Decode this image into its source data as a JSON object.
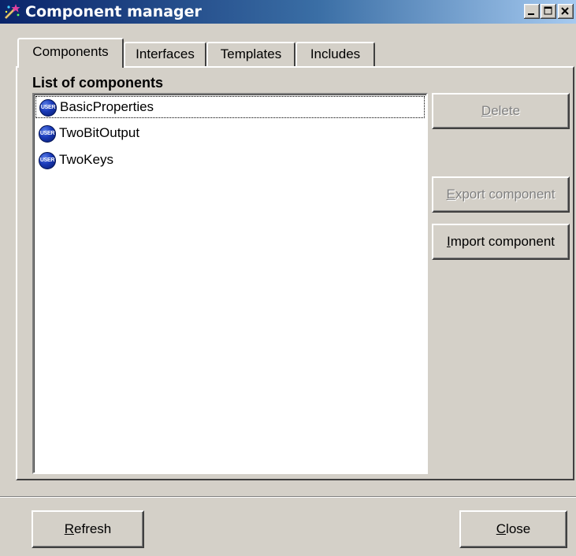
{
  "window": {
    "title": "Component manager",
    "controls": [
      "minimize-icon",
      "maximize-icon",
      "close-icon"
    ]
  },
  "tabs": [
    {
      "label": "Components",
      "active": true
    },
    {
      "label": "Interfaces",
      "active": false
    },
    {
      "label": "Templates",
      "active": false
    },
    {
      "label": "Includes",
      "active": false
    }
  ],
  "list": {
    "title": "List of components",
    "icon_text": "USER",
    "items": [
      {
        "label": "BasicProperties",
        "icon": "user-component-icon",
        "focused": true
      },
      {
        "label": "TwoBitOutput",
        "icon": "user-component-icon",
        "focused": false
      },
      {
        "label": "TwoKeys",
        "icon": "user-component-icon",
        "focused": false
      }
    ]
  },
  "buttons": {
    "delete": {
      "hotkey": "D",
      "rest": "elete",
      "enabled": false
    },
    "export": {
      "hotkey": "E",
      "rest": "xport component",
      "enabled": false
    },
    "import": {
      "hotkey": "I",
      "rest": "mport component",
      "enabled": true
    },
    "refresh": {
      "hotkey": "R",
      "rest": "efresh",
      "enabled": true
    },
    "close": {
      "hotkey": "C",
      "rest": "lose",
      "enabled": true
    }
  }
}
